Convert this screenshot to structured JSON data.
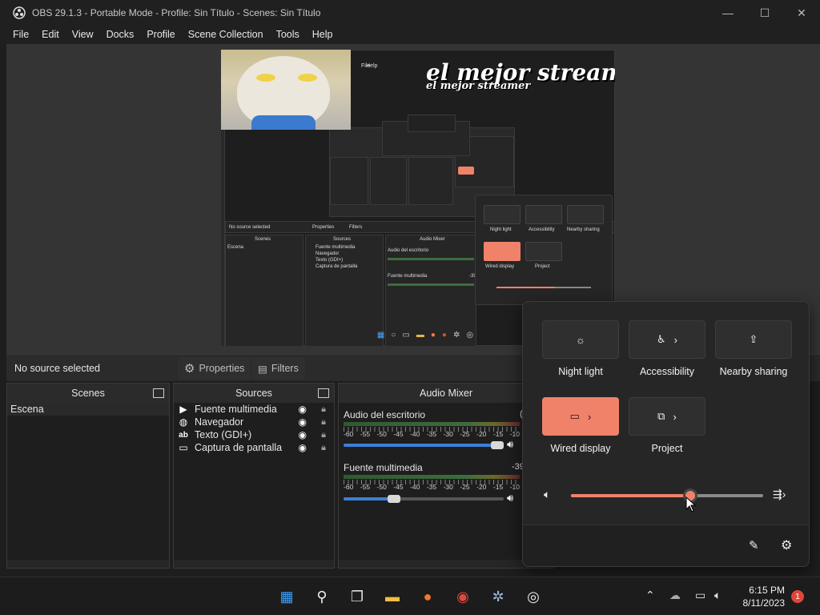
{
  "window": {
    "title": "OBS 29.1.3 - Portable Mode - Profile: Sin Título - Scenes: Sin Título",
    "controls": [
      "—",
      "☐",
      "✕"
    ]
  },
  "menu": [
    "File",
    "Edit",
    "View",
    "Docks",
    "Profile",
    "Scene Collection",
    "Tools",
    "Help"
  ],
  "preview": {
    "overlay_text": "el mejor streamer",
    "nested_menu": [
      "File",
      "Help"
    ],
    "nested_no_source": "No source selected",
    "nested_properties": "Properties",
    "nested_filters": "Filters",
    "nested_scenes": "Scenes",
    "nested_sources": "Sources",
    "nested_mixer": "Audio Mixer",
    "nested_scene_item": "Escena",
    "nested_source_items": [
      "Fuente multimedia",
      "Navegador",
      "Texto (GDI+)",
      "Captura de pantalla"
    ],
    "nested_mixer_items": [
      "Audio del escritorio",
      "Fuente multimedia"
    ],
    "nested_mixer_db": "-39",
    "nested_qs_tiles": [
      "Night light",
      "Accessibility",
      "Nearby sharing",
      "Wired display",
      "Project"
    ]
  },
  "source_bar": {
    "no_source": "No source selected",
    "properties": "Properties",
    "filters": "Filters"
  },
  "scenes": {
    "title": "Scenes",
    "items": [
      "Escena"
    ]
  },
  "sources": {
    "title": "Sources",
    "items": [
      {
        "label": "Fuente multimedia",
        "icon": "play-icon"
      },
      {
        "label": "Navegador",
        "icon": "globe-icon"
      },
      {
        "label": "Texto (GDI+)",
        "icon": "text-icon"
      },
      {
        "label": "Captura de pantalla",
        "icon": "monitor-icon"
      }
    ]
  },
  "mixer": {
    "title": "Audio Mixer",
    "scale": [
      "-60",
      "-55",
      "-50",
      "-45",
      "-40",
      "-35",
      "-30",
      "-25",
      "-20",
      "-15",
      "-10"
    ],
    "channels": [
      {
        "name": "Audio del escritorio",
        "db": "(",
        "volume": 1.0
      },
      {
        "name": "Fuente multimedia",
        "db": "-39",
        "volume": 0.3
      }
    ]
  },
  "quick_settings": {
    "tiles": [
      {
        "label": "Night light",
        "icon": "brightness-icon",
        "active": false
      },
      {
        "label": "Accessibility",
        "icon": "accessibility-icon",
        "active": false
      },
      {
        "label": "Nearby sharing",
        "icon": "share-icon",
        "active": false
      },
      {
        "label": "Wired display",
        "icon": "cast-icon",
        "active": true
      },
      {
        "label": "Project",
        "icon": "project-icon",
        "active": false
      }
    ],
    "volume_level": 0.63,
    "accent": "#f0826a"
  },
  "taskbar": {
    "time": "6:15 PM",
    "date": "8/11/2023",
    "notifications": "1",
    "apps": [
      "start-icon",
      "search-icon",
      "task-view-icon",
      "file-explorer-icon",
      "firefox-icon",
      "chrome-icon",
      "settings-icon",
      "obs-icon"
    ]
  }
}
